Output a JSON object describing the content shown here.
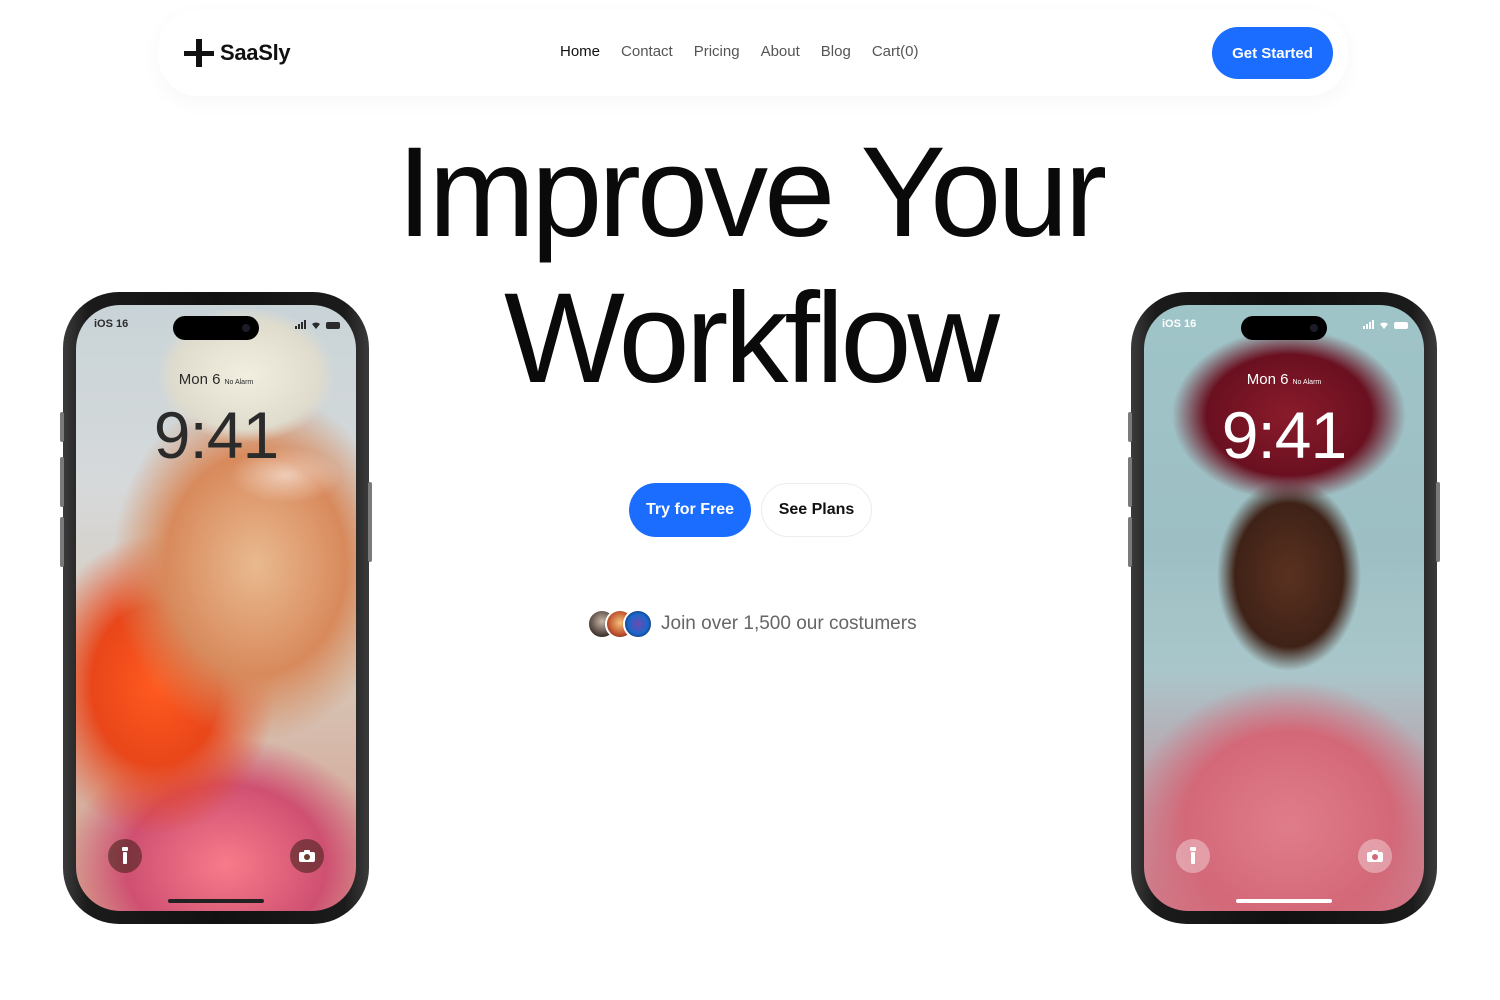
{
  "brand": {
    "name": "SaaSly"
  },
  "nav": {
    "links": [
      {
        "label": "Home",
        "active": true
      },
      {
        "label": "Contact"
      },
      {
        "label": "Pricing"
      },
      {
        "label": "About"
      },
      {
        "label": "Blog"
      },
      {
        "label": "Cart(0)"
      }
    ],
    "cta_label": "Get Started"
  },
  "hero": {
    "title_line1": "Improve Your",
    "title_line2": "Workflow",
    "primary_label": "Try for Free",
    "secondary_label": "See Plans",
    "social_text": "Join over 1,500 our costumers"
  },
  "phones": {
    "left": {
      "os": "iOS 16",
      "date": "Mon 6",
      "alarm": "No Alarm",
      "time": "9:41"
    },
    "right": {
      "os": "iOS 16",
      "date": "Mon 6",
      "alarm": "No Alarm",
      "time": "9:41"
    }
  },
  "colors": {
    "accent": "#1a6dff",
    "text": "#0a0a0a",
    "muted": "#666666"
  },
  "icons": [
    "logo-mark-icon",
    "flashlight-icon",
    "camera-icon",
    "signal-icon",
    "wifi-icon",
    "battery-icon"
  ]
}
